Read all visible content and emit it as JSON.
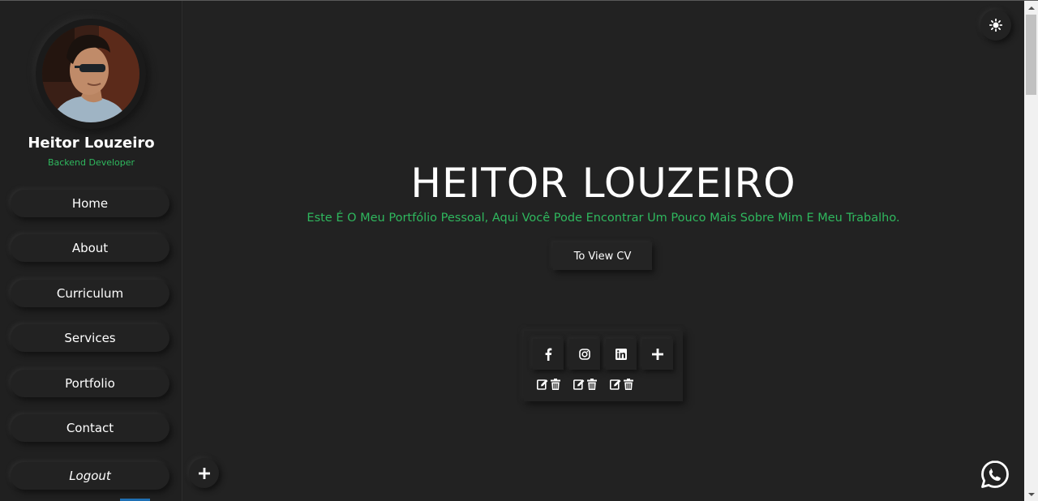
{
  "profile": {
    "name": "Heitor Louzeiro",
    "role": "Backend Developer",
    "avatar_icon": "profile-photo"
  },
  "sidebar": {
    "items": [
      {
        "label": "Home"
      },
      {
        "label": "About"
      },
      {
        "label": "Curriculum"
      },
      {
        "label": "Services"
      },
      {
        "label": "Portfolio"
      },
      {
        "label": "Contact"
      },
      {
        "label": "Logout"
      }
    ]
  },
  "hero": {
    "title": "HEITOR LOUZEIRO",
    "subtitle": "Este É O Meu Portfólio Pessoal, Aqui Você Pode Encontrar Um Pouco Mais Sobre Mim E Meu Trabalho.",
    "cv_button": "To View CV"
  },
  "social": {
    "links": [
      {
        "icon": "facebook-icon"
      },
      {
        "icon": "instagram-icon"
      },
      {
        "icon": "linkedin-icon"
      }
    ],
    "add_icon": "plus-icon",
    "actions": [
      "edit-icon",
      "trash-icon"
    ]
  },
  "floating": {
    "theme_icon": "sun-icon",
    "add_icon": "plus-icon",
    "whatsapp_icon": "whatsapp-icon"
  },
  "colors": {
    "background": "#222222",
    "sidebar": "#202020",
    "accent_green": "#2fb85e",
    "text": "#ffffff"
  }
}
